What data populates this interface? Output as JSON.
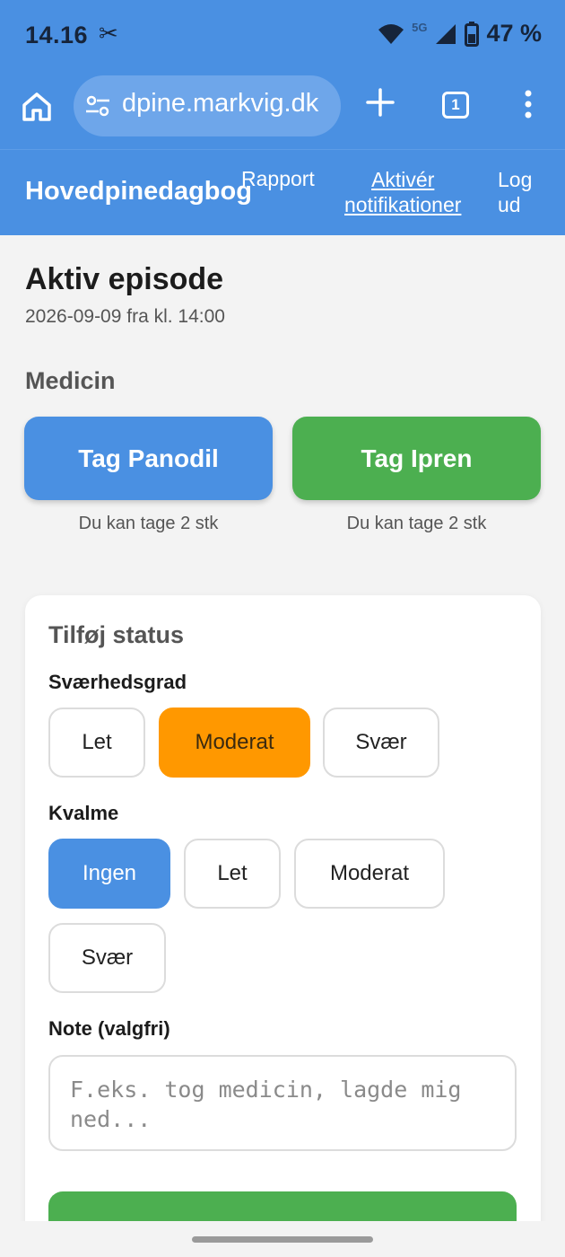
{
  "status_bar": {
    "time": "14.16",
    "network": "5G",
    "battery": "47 %"
  },
  "browser": {
    "url": "dpine.markvig.dk",
    "tab_count": "1"
  },
  "app_header": {
    "brand": "Hovedpinedagbog",
    "nav": {
      "rapport": "Rapport",
      "notifications_line1": "Aktivér",
      "notifications_line2": "notifikationer",
      "logout_line1": "Log",
      "logout_line2": "ud"
    }
  },
  "episode": {
    "title": "Aktiv episode",
    "subtitle": "2026-09-09 fra kl. 14:00"
  },
  "medicine": {
    "heading": "Medicin",
    "buttons": [
      {
        "label": "Tag Panodil",
        "note": "Du kan tage 2 stk",
        "color": "#4a90e2"
      },
      {
        "label": "Tag Ipren",
        "note": "Du kan tage 2 stk",
        "color": "#4caf50"
      }
    ]
  },
  "status_form": {
    "title": "Tilføj status",
    "severity": {
      "label": "Sværhedsgrad",
      "options": [
        "Let",
        "Moderat",
        "Svær"
      ],
      "selected": "Moderat",
      "selected_color": "#ff9800"
    },
    "nausea": {
      "label": "Kvalme",
      "options": [
        "Ingen",
        "Let",
        "Moderat",
        "Svær"
      ],
      "selected": "Ingen",
      "selected_color": "#4a90e2"
    },
    "note": {
      "label": "Note (valgfri)",
      "placeholder": "F.eks. tog medicin, lagde mig ned..."
    }
  }
}
